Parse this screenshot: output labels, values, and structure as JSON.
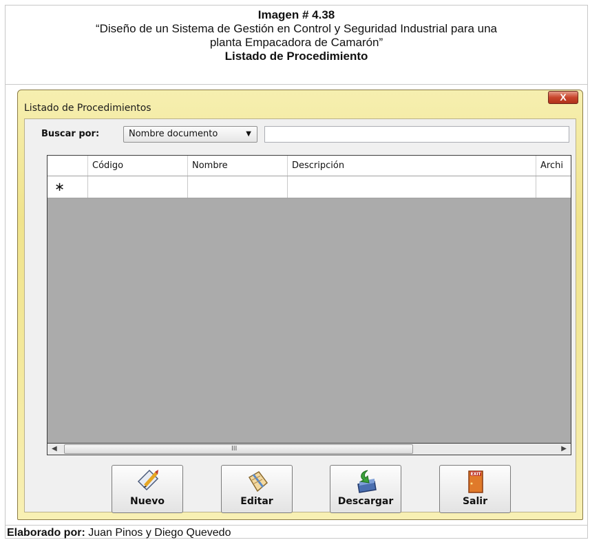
{
  "caption": {
    "label": "Imagen # 4.38",
    "title_line1": "“Diseño de un Sistema de Gestión en Control y Seguridad Industrial para una",
    "title_line2": "planta Empacadora de Camarón”",
    "subtitle": "Listado de Procedimiento"
  },
  "window": {
    "title": "Listado de Procedimientos",
    "close_label": "X"
  },
  "search": {
    "label": "Buscar por:",
    "selected": "Nombre documento",
    "value": ""
  },
  "grid": {
    "columns": [
      "",
      "Código",
      "Nombre",
      "Descripción",
      "Archi"
    ],
    "new_row_marker": "∗",
    "scroll_grip": "III"
  },
  "buttons": {
    "new": "Nuevo",
    "edit": "Editar",
    "download": "Descargar",
    "exit": "Salir",
    "exit_sign": "EXIT"
  },
  "footer": {
    "label": "Elaborado por:",
    "authors": "Juan Pinos y Diego Quevedo"
  },
  "colors": {
    "window_frame": "#f0e38c",
    "close_button": "#c8452c",
    "grid_background": "#ababab"
  }
}
